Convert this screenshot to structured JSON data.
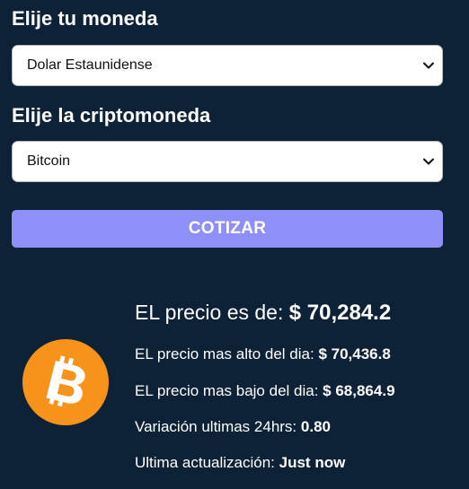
{
  "form": {
    "currency_label": "Elije tu moneda",
    "currency_selected": "Dolar Estaunidense",
    "crypto_label": "Elije la criptomoneda",
    "crypto_selected": "Bitcoin",
    "submit_label": "COTIZAR"
  },
  "result": {
    "coin_icon": "bitcoin-icon",
    "price_label": "EL precio es de:",
    "price_value": "$ 70,284.2",
    "high_label": "EL precio mas alto del dia:",
    "high_value": "$ 70,436.8",
    "low_label": "EL precio mas bajo del dia:",
    "low_value": "$ 68,864.9",
    "change_label": "Variación ultimas 24hrs:",
    "change_value": "0.80",
    "updated_label": "Ultima actualización:",
    "updated_value": "Just now"
  },
  "colors": {
    "background": "#0d2137",
    "button": "#8f8ff8",
    "bitcoin_orange": "#f7931a"
  }
}
